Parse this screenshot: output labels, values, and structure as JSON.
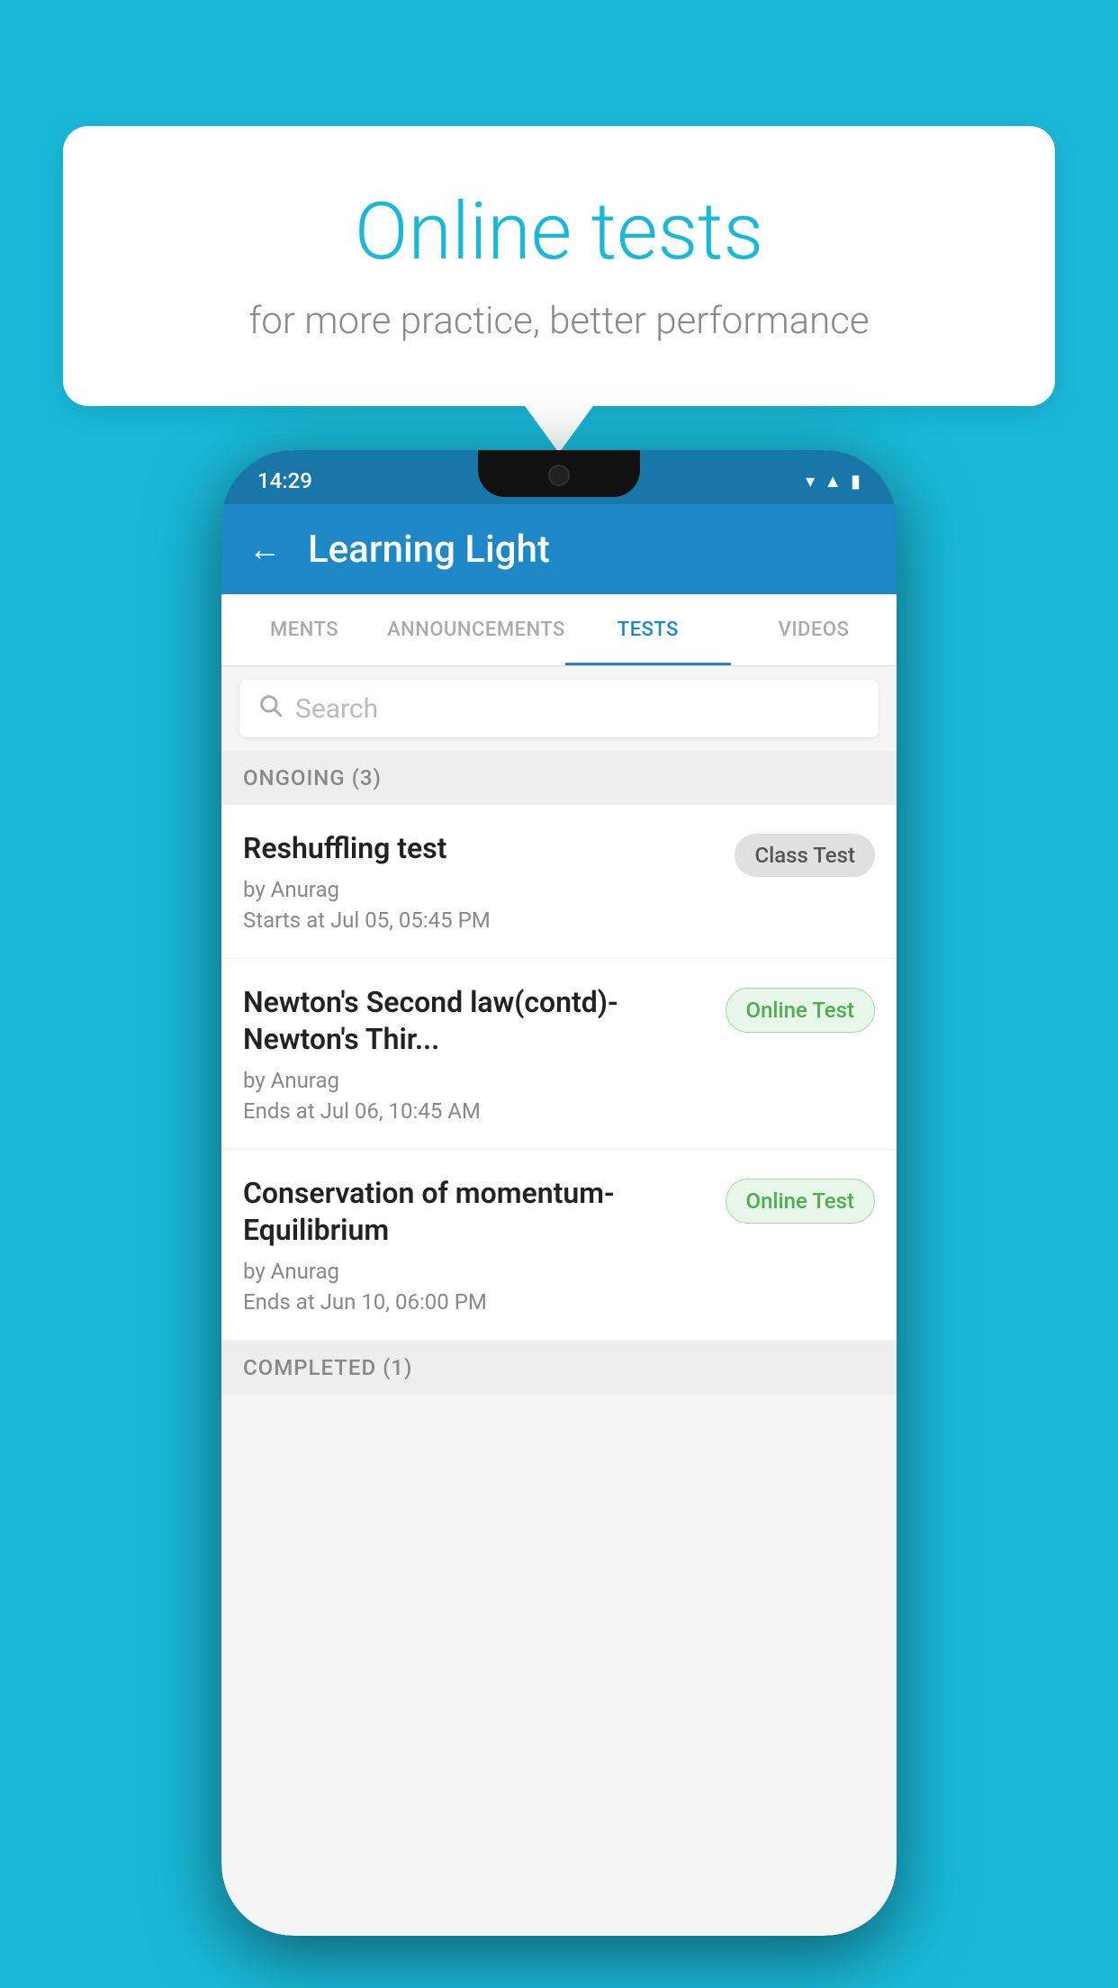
{
  "background_color": "#1ab8d8",
  "speech_bubble": {
    "title": "Online tests",
    "subtitle": "for more practice, better performance"
  },
  "phone": {
    "status_bar": {
      "time": "14:29",
      "icons": [
        "wifi",
        "signal",
        "battery"
      ]
    },
    "app_bar": {
      "title": "Learning Light",
      "back_label": "←"
    },
    "tabs": [
      {
        "label": "MENTS",
        "active": false
      },
      {
        "label": "ANNOUNCEMENTS",
        "active": false
      },
      {
        "label": "TESTS",
        "active": true
      },
      {
        "label": "VIDEOS",
        "active": false
      }
    ],
    "search": {
      "placeholder": "Search"
    },
    "ongoing_section": {
      "label": "ONGOING (3)"
    },
    "test_items": [
      {
        "name": "Reshuffling test",
        "by": "by Anurag",
        "time_label": "Starts at",
        "time": "Jul 05, 05:45 PM",
        "badge": "Class Test",
        "badge_type": "class"
      },
      {
        "name": "Newton's Second law(contd)-Newton's Thir...",
        "by": "by Anurag",
        "time_label": "Ends at",
        "time": "Jul 06, 10:45 AM",
        "badge": "Online Test",
        "badge_type": "online"
      },
      {
        "name": "Conservation of momentum-Equilibrium",
        "by": "by Anurag",
        "time_label": "Ends at",
        "time": "Jun 10, 06:00 PM",
        "badge": "Online Test",
        "badge_type": "online"
      }
    ],
    "completed_section": {
      "label": "COMPLETED (1)"
    }
  }
}
